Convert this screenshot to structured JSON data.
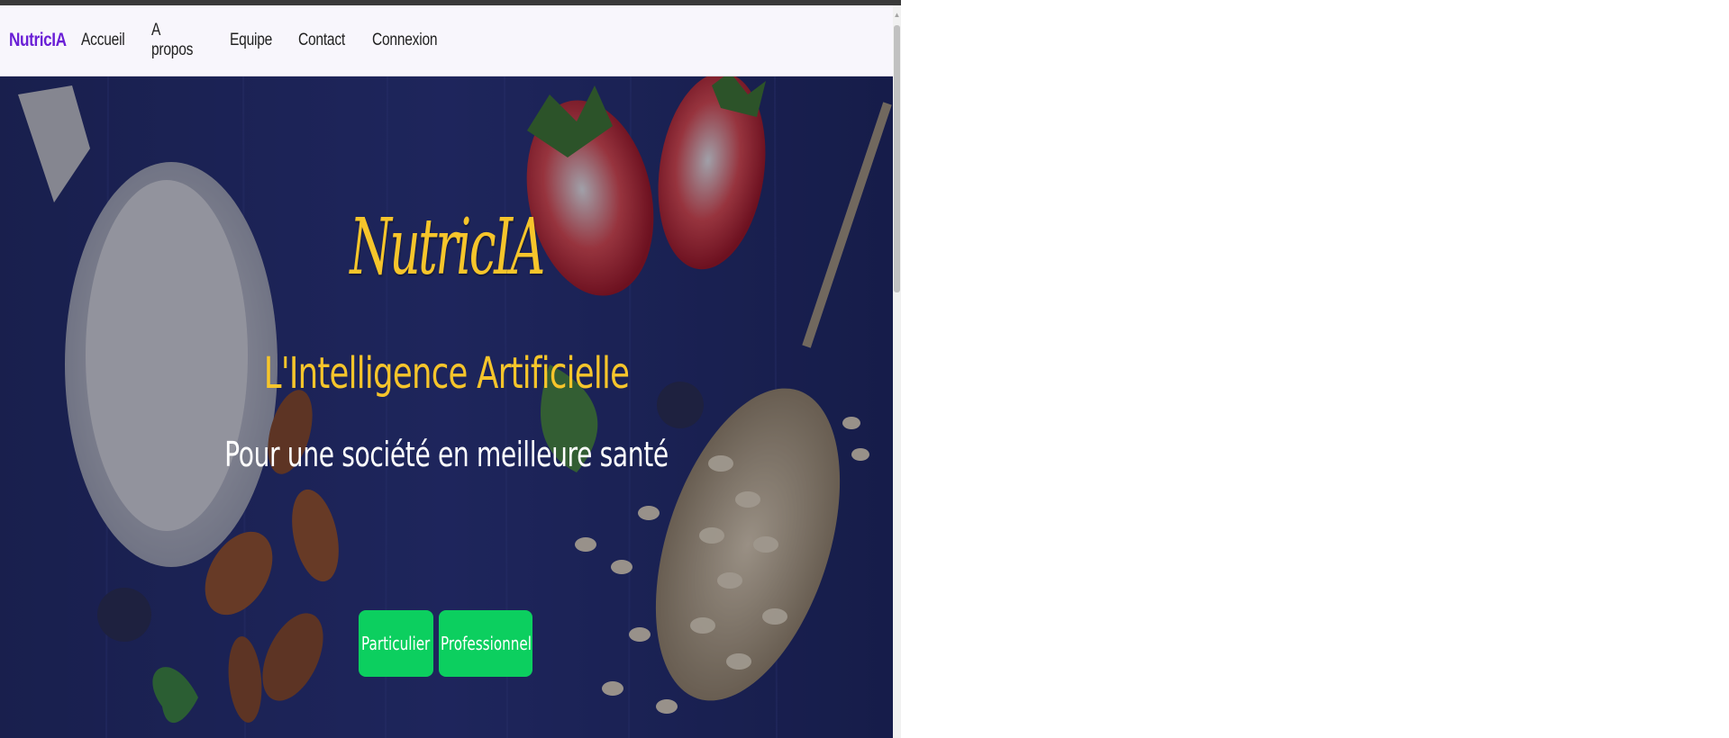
{
  "navbar": {
    "brand": "NutricIA",
    "links": [
      "Accueil",
      "A propos",
      "Equipe",
      "Contact",
      "Connexion"
    ]
  },
  "hero": {
    "title": "NutricIA",
    "subtitle": "L'Intelligence Artificielle",
    "tagline": "Pour une société en meilleure santé",
    "buttons": [
      "Particulier",
      "Professionnel"
    ]
  },
  "colors": {
    "brand": "#6a1fd6",
    "accent_yellow": "#f6c52b",
    "button_green": "#0ccf5f",
    "hero_background": "#1c2459"
  },
  "icons": {
    "scroll_up": "scroll-up-arrow-icon"
  }
}
